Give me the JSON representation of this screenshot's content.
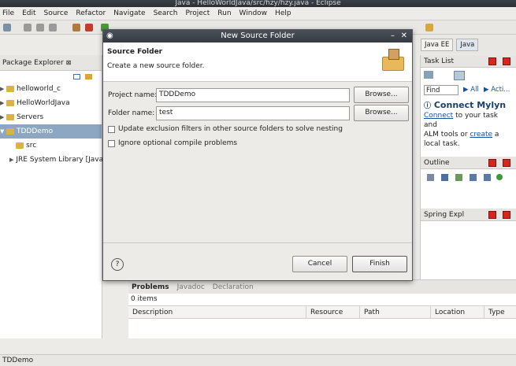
{
  "window": {
    "title": "Java - HelloWorldJava/src/hzy/hzy.java - Eclipse"
  },
  "menu": [
    "File",
    "Edit",
    "Source",
    "Refactor",
    "Navigate",
    "Search",
    "Project",
    "Run",
    "Window",
    "Help"
  ],
  "perspectives": [
    "Java EE",
    "Java"
  ],
  "package_explorer": {
    "title": "Package Explorer",
    "items": [
      {
        "label": "helloworld_c"
      },
      {
        "label": "HelloWorldJava"
      },
      {
        "label": "Servers"
      },
      {
        "label": "TDDDemo"
      },
      {
        "label": "src"
      },
      {
        "label": "JRE System Library [Java"
      }
    ]
  },
  "dialog": {
    "title": "New Source Folder",
    "header_title": "Source Folder",
    "header_desc": "Create a new source folder.",
    "project_label": "Project name:",
    "project_value": "TDDDemo",
    "folder_label": "Folder name:",
    "folder_value": "test",
    "browse1": "Browse...",
    "browse2": "Browse...",
    "chk1": "Update exclusion filters in other source folders to solve nesting",
    "chk2": "Ignore optional compile problems",
    "help": "?",
    "cancel": "Cancel",
    "finish": "Finish"
  },
  "task_list": {
    "title": "Task List",
    "find": "Find",
    "all": "All",
    "acti": "Acti..."
  },
  "mylyn": {
    "title": "Connect Mylyn",
    "connect": "Connect",
    "text1": " to your task and",
    "text2": "ALM tools or ",
    "create": "create",
    "text3": " a",
    "text4": "local task."
  },
  "outline": {
    "title": "Outline"
  },
  "spring": {
    "title": "Spring Expl"
  },
  "bottom": {
    "tabs": [
      "Problems",
      "Javadoc",
      "Declaration"
    ],
    "count": "0 items",
    "columns": [
      "Description",
      "Resource",
      "Path",
      "Location",
      "Type"
    ]
  },
  "status": "TDDemo"
}
